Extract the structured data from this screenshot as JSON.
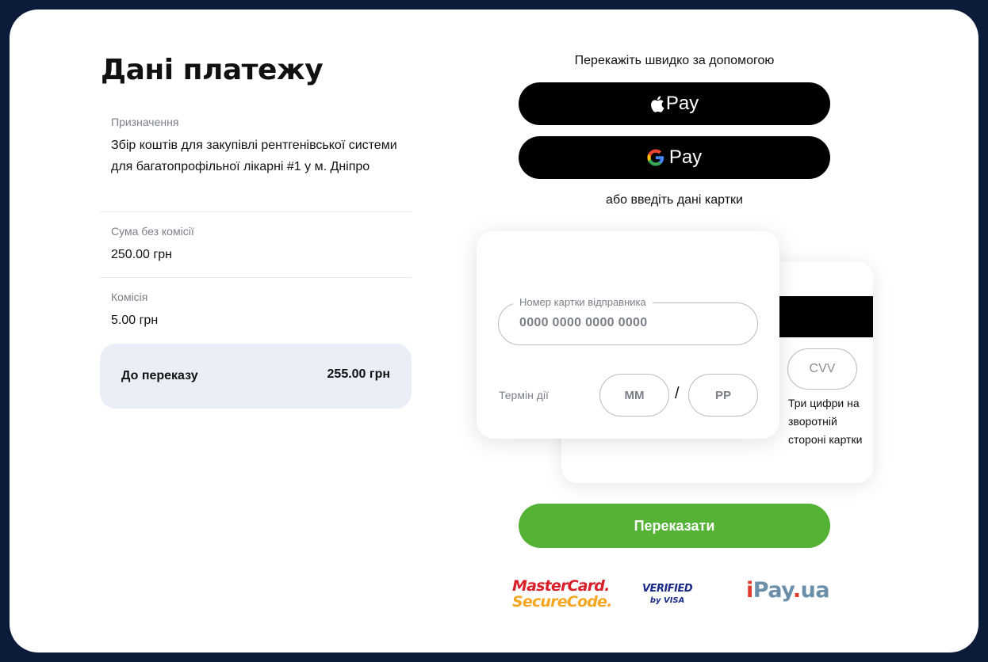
{
  "title": "Дані платежу",
  "payment": {
    "purpose_label": "Призначення",
    "purpose_value": "Збір коштів для закупівлі рентгенівської системи для багатопрофільної лікарні #1 у м. Дніпро",
    "amount_label": "Сума без комісії",
    "amount_value": "250.00 грн",
    "fee_label": "Комісія",
    "fee_value": "5.00 грн",
    "total_label": "До переказу",
    "total_value": "255.00 грн"
  },
  "quick_pay": {
    "heading": "Перекажіть швидко за допомогою",
    "apple_pay": "Pay",
    "google_pay": "Pay",
    "or_card": "або введіть дані картки"
  },
  "card": {
    "number_label": "Номер картки відправника",
    "number_placeholder": "0000 0000 0000 0000",
    "term_label": "Термін дії",
    "month_placeholder": "ММ",
    "separator": "/",
    "year_placeholder": "РР",
    "cvv_placeholder": "CVV",
    "cvv_hint": "Три цифри на зворотній стороні картки"
  },
  "submit_label": "Переказати",
  "logos": {
    "mastercard_line1": "MasterCard.",
    "mastercard_line2": "SecureCode.",
    "visa_line1": "VERIFIED",
    "visa_line2": "by VISA",
    "ipay_i": "i",
    "ipay_pay": "Pay",
    "ipay_dot": ".",
    "ipay_ua": "ua"
  },
  "colors": {
    "frame": "#0d1b3a",
    "accent_green": "#54b235",
    "total_bg": "#eaeef6",
    "mastercard_red": "#d8202a",
    "mastercard_orange": "#f5a623",
    "visa_blue": "#1a2a8a",
    "ipay_red": "#e03a2e",
    "ipay_blue": "#6b8fa8"
  }
}
